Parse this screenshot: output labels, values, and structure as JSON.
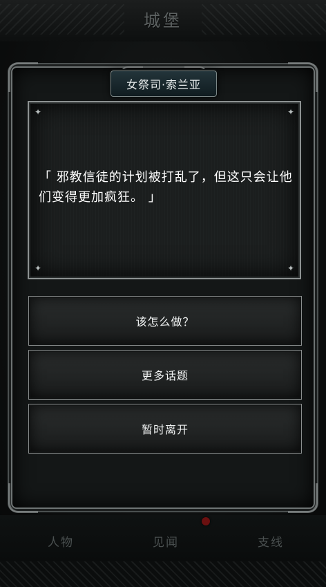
{
  "header": {
    "title": "城堡"
  },
  "dialog": {
    "speaker": "女祭司·索兰亚",
    "text": "「 邪教信徒的计划被打乱了，但这只会让他们变得更加疯狂。 」"
  },
  "options": [
    {
      "label": "该怎么做？"
    },
    {
      "label": "更多话题"
    },
    {
      "label": "暂时离开"
    }
  ],
  "bottom_nav": {
    "tabs": [
      {
        "label": "人物"
      },
      {
        "label": "见闻"
      },
      {
        "label": "支线"
      }
    ]
  },
  "colors": {
    "text_primary": "#ffffff",
    "nav_inactive": "#4b5151",
    "badge": "#6b1010",
    "title_plate": "#23343a"
  }
}
